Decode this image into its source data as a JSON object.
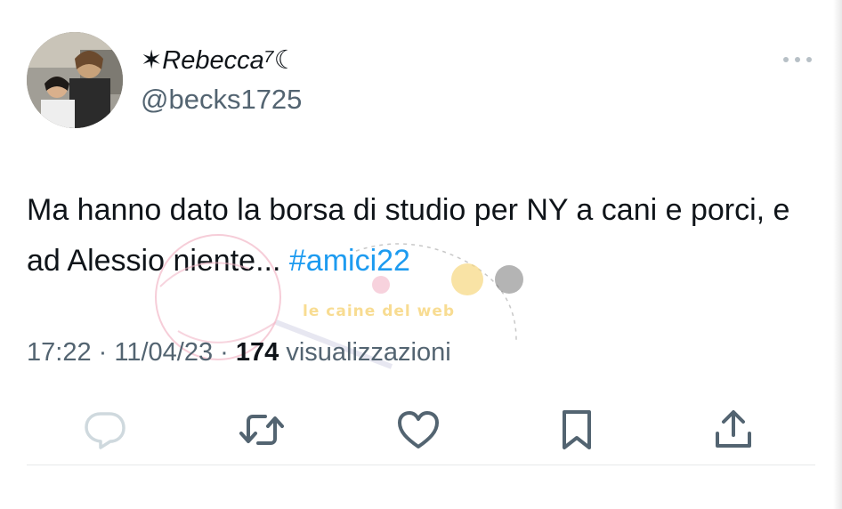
{
  "author": {
    "display_name": "✶Rebecca⁷☾",
    "handle": "@becks1725"
  },
  "tweet": {
    "text_before_hashtag": "Ma hanno dato la borsa di studio per NY a cani e porci, e ad Alessio niente... ",
    "hashtag": "#amici22"
  },
  "meta": {
    "time": "17:22",
    "separator1": " · ",
    "date": "11/04/23",
    "separator2": " · ",
    "views_count": "174",
    "views_label": " visualizzazioni"
  },
  "actions": [
    {
      "icon": "reply-icon"
    },
    {
      "icon": "retweet-icon"
    },
    {
      "icon": "like-icon"
    },
    {
      "icon": "bookmark-icon"
    },
    {
      "icon": "share-icon"
    }
  ],
  "watermark": {
    "brand": "le caine del web"
  },
  "colors": {
    "text": "#0f1419",
    "secondary": "#536471",
    "hashtag": "#1d9bf0",
    "reply_icon": "#cfd9de",
    "icon": "#536471",
    "divider": "#e7e9ea"
  }
}
